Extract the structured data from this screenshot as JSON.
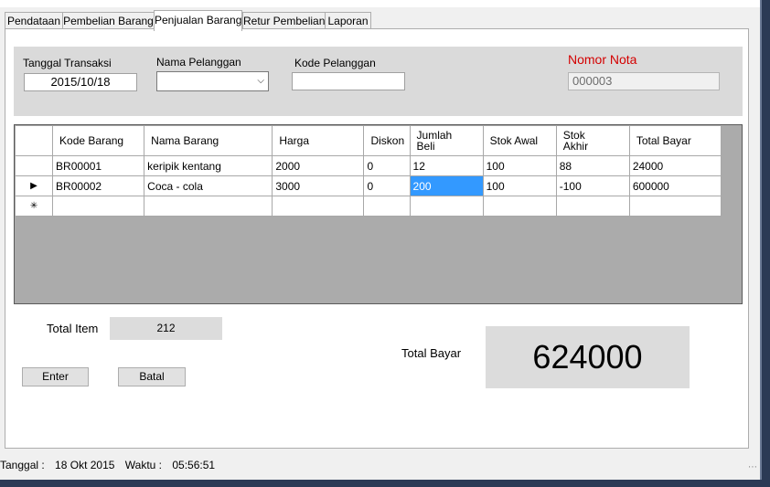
{
  "tabs": [
    "Pendataan",
    "Pembelian Barang",
    "Penjualan Barang",
    "Retur Pembelian",
    "Laporan"
  ],
  "active_tab_index": 2,
  "form": {
    "tanggal_label": "Tanggal Transaksi",
    "tanggal_value": "2015/10/18",
    "nama_pelanggan_label": "Nama Pelanggan",
    "nama_pelanggan_value": "",
    "kode_pelanggan_label": "Kode Pelanggan",
    "kode_pelanggan_value": "",
    "nomor_nota_label": "Nomor Nota",
    "nomor_nota_value": "000003"
  },
  "grid": {
    "columns": [
      "Kode Barang",
      "Nama Barang",
      "Harga",
      "Diskon",
      "Jumlah\nBeli",
      "Stok Awal",
      "Stok\nAkhir",
      "Total Bayar"
    ],
    "rows": [
      {
        "indicator": "",
        "cells": [
          "BR00001",
          "keripik kentang",
          "2000",
          "0",
          "12",
          "100",
          "88",
          "24000"
        ]
      },
      {
        "indicator": "▶",
        "cells": [
          "BR00002",
          "Coca - cola",
          "3000",
          "0",
          "200",
          "100",
          "-100",
          "600000"
        ]
      },
      {
        "indicator": "✳",
        "cells": [
          "",
          "",
          "",
          "",
          "",
          "",
          "",
          ""
        ]
      }
    ],
    "selected_cell": {
      "row": 1,
      "col": 4
    }
  },
  "summary": {
    "total_item_label": "Total Item",
    "total_item_value": "212",
    "total_bayar_label": "Total Bayar",
    "total_bayar_value": "624000"
  },
  "buttons": {
    "enter": "Enter",
    "batal": "Batal"
  },
  "status": {
    "tanggal_label": "Tanggal :",
    "tanggal_value": "18 Okt 2015",
    "waktu_label": "Waktu :",
    "waktu_value": "05:56:51"
  },
  "colors": {
    "selection": "#3399ff",
    "nomor_nota_label": "#d40000",
    "grid_background": "#ababab"
  }
}
